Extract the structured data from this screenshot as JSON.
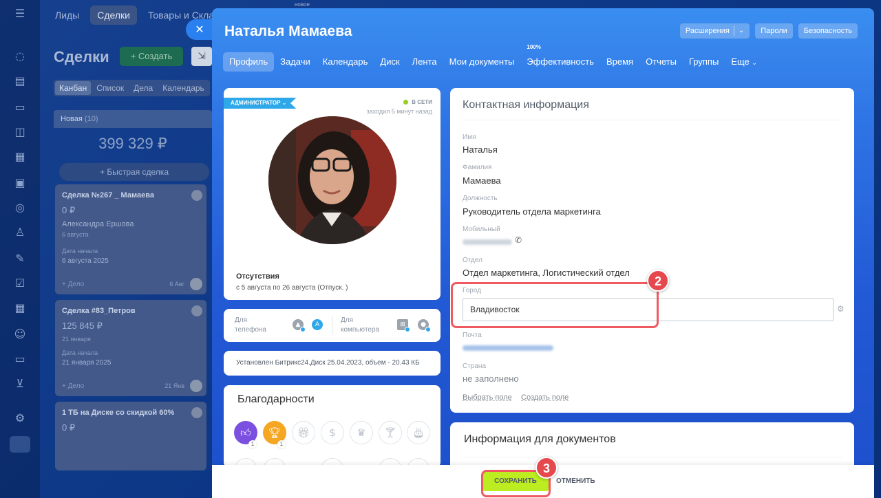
{
  "background": {
    "top_tabs": [
      "Лиды",
      "Сделки",
      "Товары и Склады"
    ],
    "new_tag": "новое",
    "page_title": "Сделки",
    "create_label": "Создать",
    "view_tabs": [
      "Канбан",
      "Список",
      "Дела",
      "Календарь"
    ],
    "column_name": "Новая",
    "column_count": "(10)",
    "column_sum": "399 329 ₽",
    "quick_deal": "Быстрая сделка",
    "cards": [
      {
        "title": "Сделка №267 _ Мамаева",
        "amount": "0 ₽",
        "contact": "Александра Ершова",
        "date": "6 августа",
        "start_label": "Дата начала",
        "start": "6 августа 2025",
        "deal": "+ Дело",
        "due": "6 Авг"
      },
      {
        "title": "Сделка #83_Петров",
        "amount": "125 845 ₽",
        "contact": "",
        "date": "21 января",
        "start_label": "Дата начала",
        "start": "21 января 2025",
        "deal": "+ Дело",
        "due": "21 Янв"
      },
      {
        "title": "1 ТБ на Диске со скидкой 60%",
        "amount": "0 ₽"
      }
    ]
  },
  "panel": {
    "title": "Наталья Мамаева",
    "header_buttons": {
      "extensions": "Расширения",
      "passwords": "Пароли",
      "security": "Безопасность"
    },
    "nav": [
      {
        "label": "Профиль",
        "active": true
      },
      {
        "label": "Задачи"
      },
      {
        "label": "Календарь"
      },
      {
        "label": "Диск"
      },
      {
        "label": "Лента"
      },
      {
        "label": "Мои документы"
      },
      {
        "label": "Эффективность",
        "sup": "100%"
      },
      {
        "label": "Время"
      },
      {
        "label": "Отчеты"
      },
      {
        "label": "Группы"
      },
      {
        "label": "Еще"
      }
    ],
    "profile": {
      "role": "АДМИНИСТРАТОР",
      "status": "В СЕТИ",
      "last_seen": "заходил 5 минут назад",
      "absence_title": "Отсутствия",
      "absence_value": "с 5 августа по 26 августа (Отпуск. )"
    },
    "apps": {
      "phone_label": "Для телефона",
      "computer_label": "Для компьютера"
    },
    "disk_info": "Установлен Битрикс24.Диск 25.04.2023, объем - 20.43 КБ",
    "thanks": {
      "title": "Благодарности",
      "counts": [
        "1",
        "1"
      ]
    },
    "contact": {
      "title": "Контактная информация",
      "fields": {
        "first_name": {
          "label": "Имя",
          "value": "Наталья"
        },
        "last_name": {
          "label": "Фамилия",
          "value": "Мамаева"
        },
        "position": {
          "label": "Должность",
          "value": "Руководитель отдела маркетинга"
        },
        "mobile": {
          "label": "Мобильный"
        },
        "department": {
          "label": "Отдел",
          "value": "Отдел маркетинга, Логистический отдел"
        },
        "city": {
          "label": "Город",
          "value": "Владивосток"
        },
        "email": {
          "label": "Почта"
        },
        "country": {
          "label": "Страна",
          "value": "не заполнено"
        }
      },
      "select_field": "Выбрать поле",
      "create_field": "Создать поле"
    },
    "documents_title": "Информация для документов",
    "footer": {
      "save": "СОХРАНИТЬ",
      "cancel": "ОТМЕНИТЬ"
    }
  },
  "annotations": {
    "step_city": "2",
    "step_save": "3"
  },
  "colors": {
    "accent_blue": "#2e72e4",
    "save_green": "#bbed21",
    "highlight_red": "#ee5a5f"
  }
}
